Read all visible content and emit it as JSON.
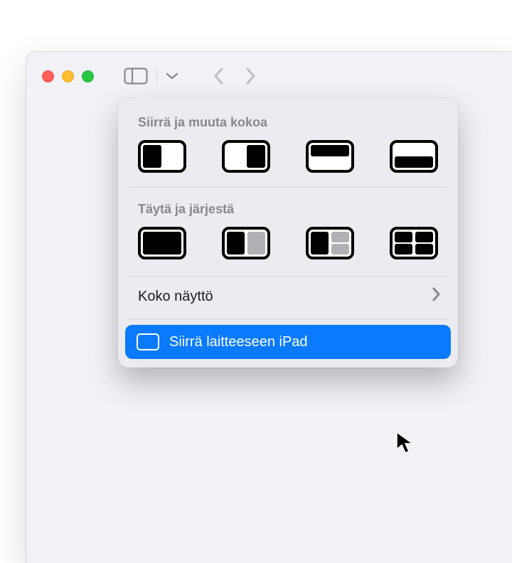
{
  "menu": {
    "move_resize_label": "Siirrä ja muuta kokoa",
    "fill_arrange_label": "Täytä ja järjestä",
    "fullscreen_label": "Koko näyttö",
    "move_to_device_label": "Siirrä laitteeseen iPad",
    "move_resize_options": [
      "left-half",
      "right-half",
      "top-half",
      "bottom-half"
    ],
    "fill_arrange_options": [
      "full",
      "halves",
      "left-right-stack",
      "quadrants"
    ]
  }
}
